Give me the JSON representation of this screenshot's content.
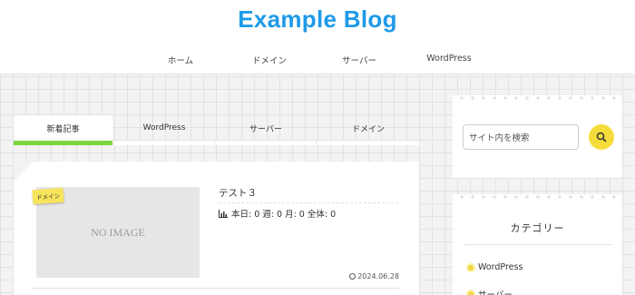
{
  "site": {
    "title": "Example Blog"
  },
  "nav": [
    "ホーム",
    "ドメイン",
    "サーバー",
    "WordPress"
  ],
  "tabs": [
    "新着記事",
    "WordPress",
    "サーバー",
    "ドメイン"
  ],
  "post": {
    "category": "ドメイン",
    "thumbnail_text": "NO IMAGE",
    "title": "テスト３",
    "views": "本日: 0  週: 0  月: 0  全体: 0",
    "date": "2024.06.28"
  },
  "search": {
    "placeholder": "サイト内を検索"
  },
  "categories_widget": {
    "title": "カテゴリー",
    "items": [
      "WordPress",
      "サーバー"
    ]
  },
  "colors": {
    "brand": "#1f9ae8",
    "tab_active": "#7fd53f",
    "accent_yellow": "#f5dc3b"
  }
}
